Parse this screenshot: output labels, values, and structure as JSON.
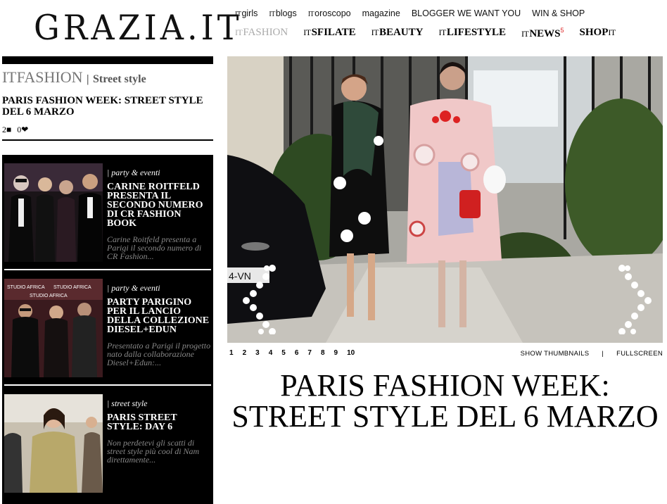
{
  "header": {
    "logo": "GRAZIA.IT",
    "nav_top": [
      {
        "prefix": "IT",
        "label": "girls"
      },
      {
        "prefix": "IT",
        "label": "blogs"
      },
      {
        "prefix": "IT",
        "label": "oroscopo"
      },
      {
        "prefix": "",
        "label": "magazine"
      },
      {
        "prefix": "",
        "label": "BLOGGER WE WANT YOU"
      },
      {
        "prefix": "",
        "label": "WIN & SHOP"
      }
    ],
    "nav_main": [
      {
        "prefix": "IT",
        "label": "FASHION"
      },
      {
        "prefix": "IT",
        "label": "SFILATE"
      },
      {
        "prefix": "IT",
        "label": "BEAUTY"
      },
      {
        "prefix": "IT",
        "label": "LIFESTYLE"
      },
      {
        "prefix": "IT",
        "label": "NEWS",
        "badge": "5"
      },
      {
        "prefix": "",
        "label": "SHOP",
        "suffix": "IT"
      }
    ]
  },
  "section": {
    "prefix": "IT",
    "name": "FASHION",
    "separator": "|",
    "subsection": "Street style"
  },
  "article": {
    "title": "PARIS FASHION WEEK: STREET STYLE DEL 6 MARZO",
    "comments": "2",
    "likes": "0"
  },
  "related": [
    {
      "category": "| party & eventi",
      "title": "CARINE ROITFELD PRESENTA IL SECONDO NUMERO DI CR FASHION BOOK",
      "description": "Carine Roitfeld presenta a Parigi il secondo numero di CR Fashion..."
    },
    {
      "category": "| party & eventi",
      "title": "PARTY PARIGINO PER IL LANCIO DELLA COLLEZIONE DIESEL+EDUN",
      "description": "Presentato a Parigi il progetto nato dalla collaborazione Diesel+Edun:...",
      "image_text": [
        "STUDIO AFRICA",
        "STUDIO AFRICA",
        "STUDIO AFRICA"
      ]
    },
    {
      "category": "| street style",
      "title": "PARIS STREET STYLE: DAY 6",
      "description": "Non perdetevi gli scatti di street style più cool di Nam direttamente..."
    }
  ],
  "gallery": {
    "pages": [
      "1",
      "2",
      "3",
      "4",
      "5",
      "6",
      "7",
      "8",
      "9",
      "10"
    ],
    "show_thumbnails": "SHOW THUMBNAILS",
    "separator": "|",
    "fullscreen": "FULLSCREEN",
    "car_plate": "4-VN",
    "colors": {
      "accent_red": "#d22222",
      "dark": "#000000"
    }
  },
  "main_title": "PARIS FASHION WEEK: STREET STYLE DEL 6 MARZO"
}
